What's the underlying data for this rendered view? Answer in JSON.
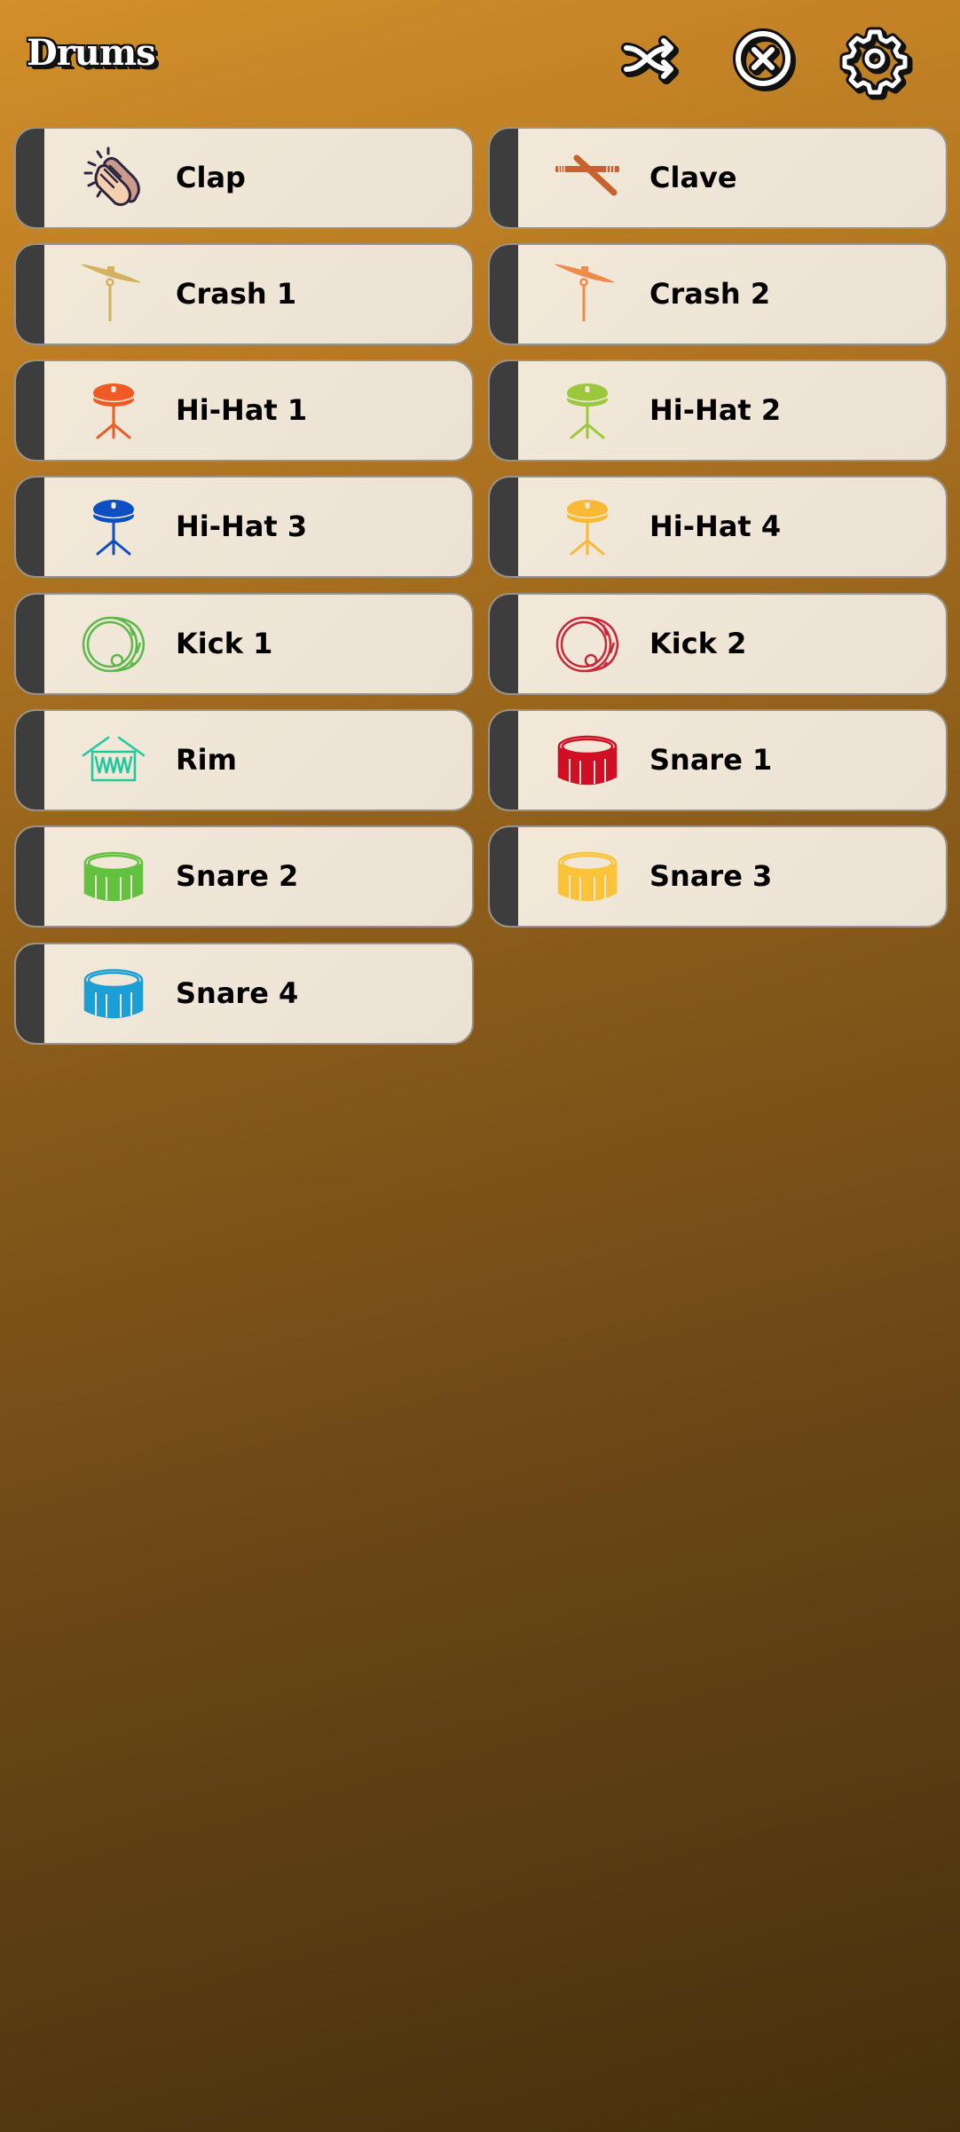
{
  "header": {
    "title": "Drums",
    "buttons": [
      {
        "name": "shuffle-button",
        "icon": "shuffle-icon"
      },
      {
        "name": "close-button",
        "icon": "close-circle-icon"
      },
      {
        "name": "settings-button",
        "icon": "gear-icon"
      }
    ]
  },
  "instruments": [
    {
      "label": "Clap",
      "icon": "clap-icon",
      "color": "#2d2640"
    },
    {
      "label": "Clave",
      "icon": "clave-icon",
      "color": "#c8602f"
    },
    {
      "label": "Crash 1",
      "icon": "crash-cymbal-icon",
      "color": "#d2b25e"
    },
    {
      "label": "Crash 2",
      "icon": "crash-cymbal-icon",
      "color": "#f08a4b"
    },
    {
      "label": "Hi-Hat 1",
      "icon": "hihat-icon",
      "color": "#f05a23"
    },
    {
      "label": "Hi-Hat 2",
      "icon": "hihat-icon",
      "color": "#9ac83a"
    },
    {
      "label": "Hi-Hat 3",
      "icon": "hihat-icon",
      "color": "#0b4fc2"
    },
    {
      "label": "Hi-Hat 4",
      "icon": "hihat-icon",
      "color": "#f9b935"
    },
    {
      "label": "Kick 1",
      "icon": "kick-drum-icon",
      "color": "#5cb84a"
    },
    {
      "label": "Kick 2",
      "icon": "kick-drum-icon",
      "color": "#c8283a"
    },
    {
      "label": "Rim",
      "icon": "rim-icon",
      "color": "#1ec9a0"
    },
    {
      "label": "Snare 1",
      "icon": "snare-drum-icon",
      "color": "#d10f24"
    },
    {
      "label": "Snare 2",
      "icon": "snare-drum-icon",
      "color": "#62c23f"
    },
    {
      "label": "Snare 3",
      "icon": "snare-drum-icon",
      "color": "#fbc33a"
    },
    {
      "label": "Snare 4",
      "icon": "snare-drum-icon",
      "color": "#1aa0d6"
    }
  ]
}
